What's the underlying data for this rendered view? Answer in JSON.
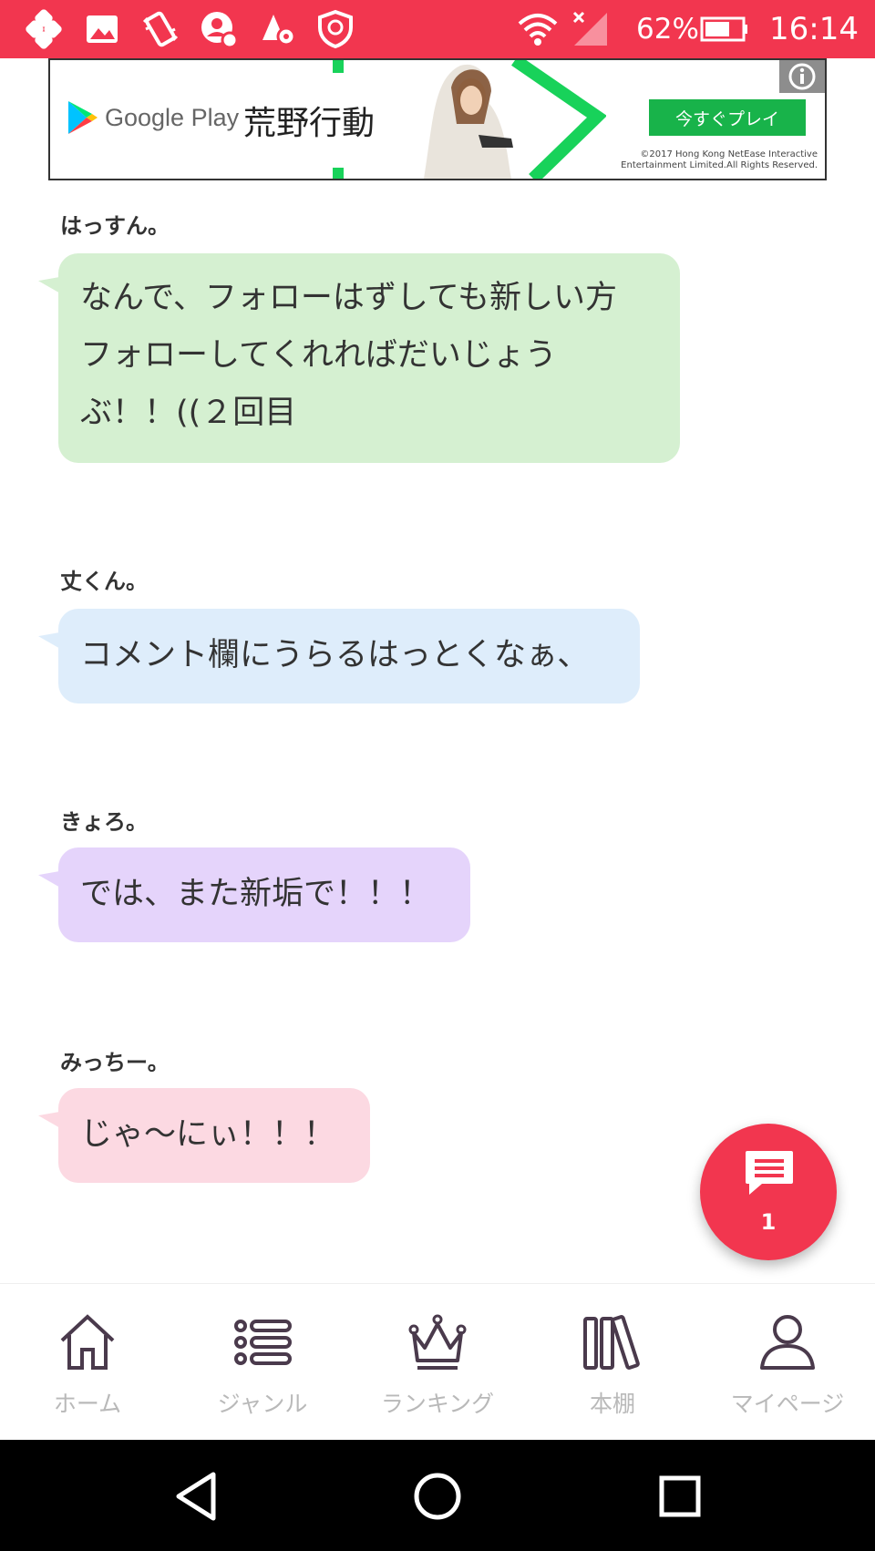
{
  "status_bar": {
    "battery": "62%",
    "time": "16:14",
    "icons": [
      "dropbox-like-icon",
      "gallery-icon",
      "vibrate-icon",
      "account-icon",
      "settings-app-icon",
      "shield-icon",
      "wifi-icon",
      "signal-icon",
      "battery-icon"
    ]
  },
  "ad": {
    "store_label": "Google Play",
    "title": "荒野行動",
    "cta": "今すぐプレイ",
    "copyright_1": "©2017 Hong Kong NetEase Interactive",
    "copyright_2": "Entertainment Limited.All Rights Reserved.",
    "brand_color": "#18b34a"
  },
  "comments": [
    {
      "author": "はっすん。",
      "lines": [
        "なんで、フォローはずしても新しい方",
        "フォローしてくれればだいじょう",
        "ぶ！！((２回目"
      ],
      "color": "#d5f0d1"
    },
    {
      "author": "丈くん。",
      "lines": [
        "コメント欄にうらるはっとくなぁ、"
      ],
      "color": "#deedfb"
    },
    {
      "author": "きょろ。",
      "lines": [
        "では、また新垢で！！！"
      ],
      "color": "#e5d4fb"
    },
    {
      "author": "みっちー。",
      "lines": [
        "じゃ〜にぃ！！！"
      ],
      "color": "#fcd9e2"
    }
  ],
  "fab": {
    "count": "1",
    "color": "#f2364f"
  },
  "bottom_nav": [
    {
      "label": "ホーム",
      "icon": "home-icon"
    },
    {
      "label": "ジャンル",
      "icon": "list-icon"
    },
    {
      "label": "ランキング",
      "icon": "crown-icon"
    },
    {
      "label": "本棚",
      "icon": "bookshelf-icon"
    },
    {
      "label": "マイページ",
      "icon": "person-icon"
    }
  ]
}
